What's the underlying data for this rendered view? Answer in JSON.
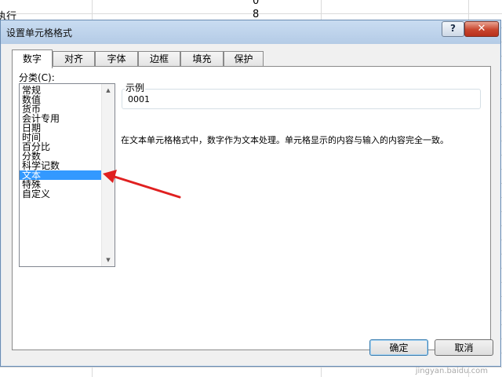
{
  "background_sheet": {
    "row1_value": "0",
    "row2_text": "执行",
    "row2_value": "8"
  },
  "dialog": {
    "title": "设置单元格格式",
    "help_label": "?",
    "close_label": "✕"
  },
  "tabs": [
    {
      "label": "数字",
      "active": true
    },
    {
      "label": "对齐"
    },
    {
      "label": "字体"
    },
    {
      "label": "边框"
    },
    {
      "label": "填充"
    },
    {
      "label": "保护"
    }
  ],
  "category": {
    "label": "分类(C):",
    "items": [
      "常规",
      "数值",
      "货币",
      "会计专用",
      "日期",
      "时间",
      "百分比",
      "分数",
      "科学记数",
      "文本",
      "特殊",
      "自定义"
    ],
    "selected": "文本"
  },
  "sample": {
    "legend": "示例",
    "value": "0001"
  },
  "description": "在文本单元格格式中，数字作为文本处理。单元格显示的内容与输入的内容完全一致。",
  "buttons": {
    "ok": "确定",
    "cancel": "取消"
  },
  "watermark": "jingyan.baidu.com",
  "colors": {
    "selection": "#3399ff",
    "annotation_arrow": "#e02020",
    "title_bar": "#b9cfe8"
  }
}
